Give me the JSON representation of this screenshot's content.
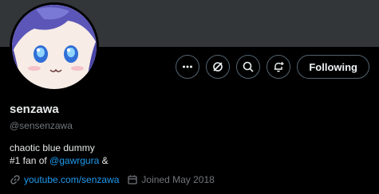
{
  "profile": {
    "display_name": "senzawa",
    "handle": "@sensenzawa",
    "bio_line1": "chaotic blue dummy",
    "bio_line2_prefix": "#1 fan of ",
    "bio_mention": "@gawrgura",
    "bio_line2_suffix": " &",
    "website": "youtube.com/senzawa",
    "joined": "Joined May 2018"
  },
  "actions": {
    "more_icon": "more-horizontal-icon",
    "grok_icon": "grok-icon",
    "search_icon": "search-icon",
    "notify_icon": "bell-plus-icon",
    "follow_label": "Following"
  },
  "colors": {
    "banner": "#333639",
    "accent": "#1d9bf0",
    "muted": "#71767b",
    "text": "#e7e9ea"
  }
}
